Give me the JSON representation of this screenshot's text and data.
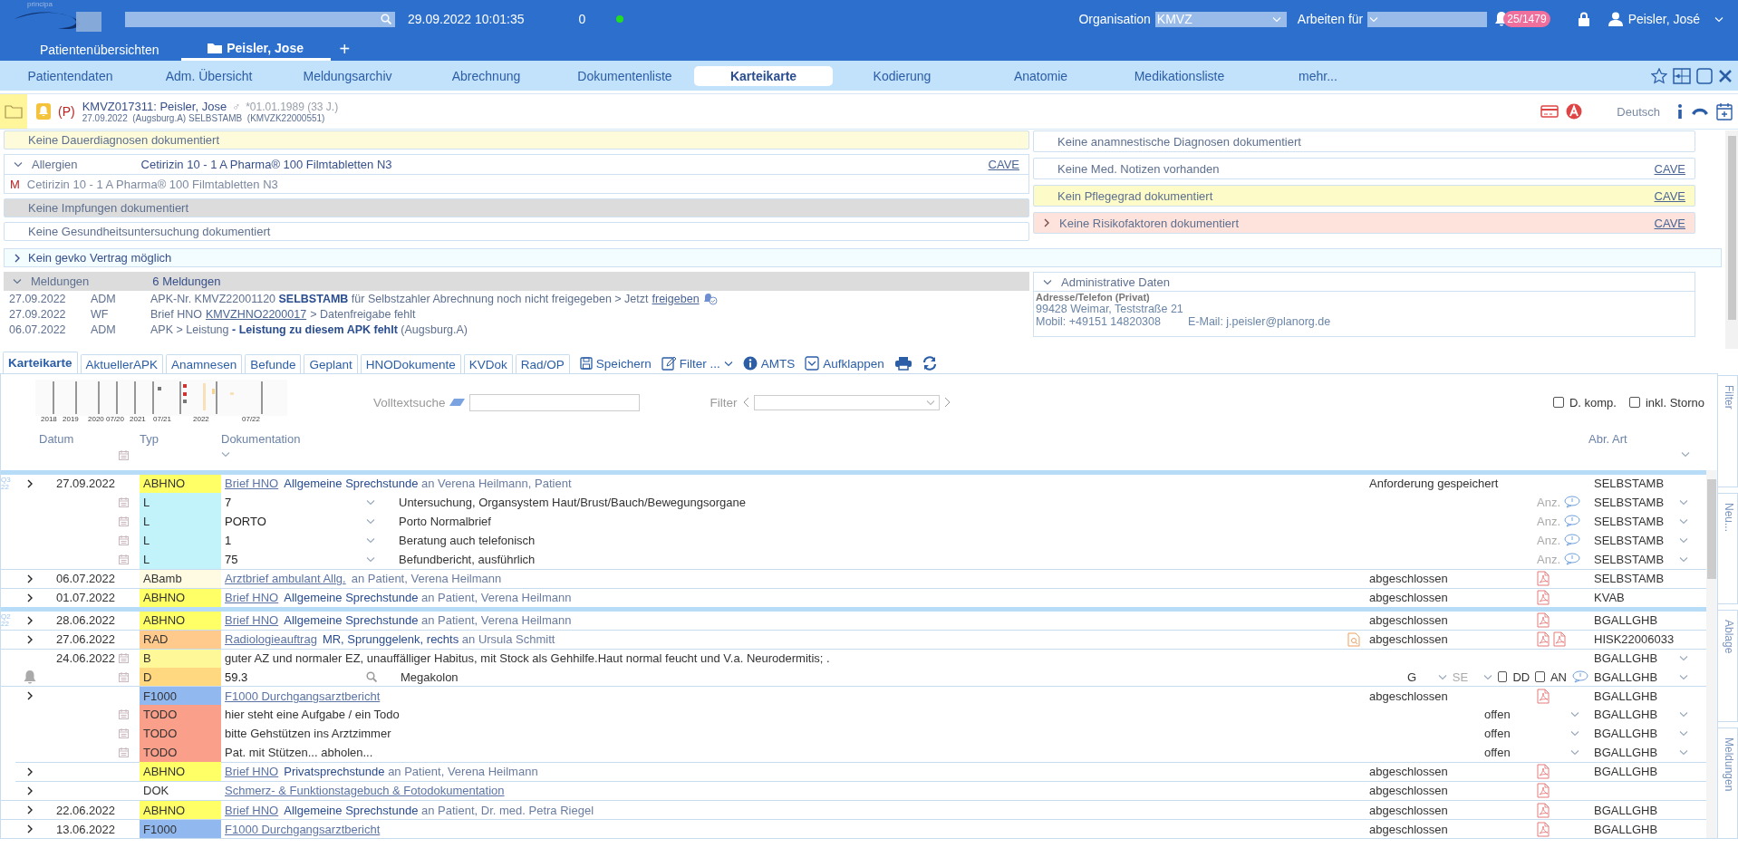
{
  "header": {
    "logo_text": "principa",
    "datetime": "29.09.2022 10:01:35",
    "counter": "0",
    "online": true,
    "organisation": {
      "label": "Organisation",
      "value": "KMVZ"
    },
    "work_for": {
      "label": "Arbeiten für"
    },
    "notifications": "25/1479",
    "user": "Peisler, José"
  },
  "patient_tabs": [
    {
      "label": "Patientenübersichten",
      "selected": false,
      "kind": "list"
    },
    {
      "label": "Peisler, Jose",
      "selected": true,
      "kind": "patient"
    }
  ],
  "add_tab": "+",
  "nav_tabs": [
    {
      "label": "Patientendaten",
      "selected": false
    },
    {
      "label": "Adm. Übersicht",
      "selected": false
    },
    {
      "label": "Meldungsarchiv",
      "selected": false
    },
    {
      "label": "Abrechnung",
      "selected": false
    },
    {
      "label": "Dokumentenliste",
      "selected": false
    },
    {
      "label": "Karteikarte",
      "selected": true
    },
    {
      "label": "Kodierung",
      "selected": false
    },
    {
      "label": "Anatomie",
      "selected": false
    },
    {
      "label": "Medikationsliste",
      "selected": false
    },
    {
      "label": "mehr...",
      "selected": false
    }
  ],
  "patient": {
    "flag": "(P)",
    "title": "KMVZ017311: Peisler, Jose",
    "gender_symbol": "♂",
    "birth": "*01.01.1989 (33 J.)",
    "subline": "27.09.2022  (Augsburg.A) SELBSTAMB  (KMVZK22000551)",
    "language": "Deutsch"
  },
  "summary_left": [
    {
      "kind": "note",
      "text": "Keine Dauerdiagnosen dokumentiert",
      "color": "#fdfbd9"
    },
    {
      "kind": "detail",
      "label": "Allergien",
      "value": "Cetirizin 10 - 1 A Pharma® 100 Filmtabletten N3",
      "link": "CAVE",
      "expanded": true,
      "items": [
        {
          "marker": "M",
          "text": "Cetirizin 10 - 1 A Pharma® 100 Filmtabletten N3"
        }
      ]
    },
    {
      "kind": "note",
      "text": "Keine Impfungen dokumentiert",
      "color": "#dcdcdc"
    },
    {
      "kind": "note",
      "text": "Keine Gesundheitsuntersuchung dokumentiert",
      "color": "#ffffff"
    }
  ],
  "summary_right": [
    {
      "kind": "note",
      "text": "Keine anamnestische Diagnosen dokumentiert",
      "color": "#ffffff"
    },
    {
      "kind": "note",
      "text": "Keine Med. Notizen vorhanden",
      "color": "#ffffff",
      "link": "CAVE"
    },
    {
      "kind": "note",
      "text": "Kein Pflegegrad dokumentiert",
      "color": "#fdfbc8",
      "link": "CAVE"
    },
    {
      "kind": "note",
      "text": "Keine Risikofaktoren dokumentiert",
      "color": "#fde3dc",
      "link": "CAVE",
      "expanded": false
    }
  ],
  "gevko": {
    "text": "Kein gevko Vertrag möglich",
    "expanded": false
  },
  "messages": {
    "label": "Meldungen",
    "summary": "6 Meldungen",
    "expanded": true,
    "rows": [
      {
        "date": "27.09.2022",
        "type": "ADM",
        "text": "APK-Nr. KMVZ22001120 **SELBSTAMB** für Selbstzahler Abrechnung noch nicht freigegeben > Jetzt",
        "link": "freigeben",
        "icon": true
      },
      {
        "date": "27.09.2022",
        "type": "WF",
        "text": "Brief HNO",
        "link": "KMVZHNO2200017",
        "after": "> Datenfreigabe fehlt",
        "icon": false
      },
      {
        "date": "06.07.2022",
        "type": "ADM",
        "text": "APK > Leistung **- Leistung zu diesem APK fehlt** (Augsburg.A)",
        "icon": false
      }
    ]
  },
  "admin": {
    "label": "Administrative Daten",
    "expanded": true,
    "heading": "Adresse/Telefon (Privat)",
    "address": "99428 Weimar, Teststraße 21",
    "phone": "Mobil: +49151 14820308",
    "email": "E-Mail: j.peisler@planorg.de"
  },
  "toolbar": {
    "tabs": [
      {
        "label": "Karteikarte",
        "selected": true
      },
      {
        "label": "AktuellerAPK",
        "selected": false
      },
      {
        "label": "Anamnesen",
        "selected": false
      },
      {
        "label": "Befunde",
        "selected": false
      },
      {
        "label": "Geplant",
        "selected": false
      },
      {
        "label": "HNODokumente",
        "selected": false
      },
      {
        "label": "KVDok",
        "selected": false
      },
      {
        "label": "Rad/OP",
        "selected": false
      }
    ],
    "actions": [
      {
        "kind": "save",
        "label": "Speichern"
      },
      {
        "kind": "filter",
        "label": "Filter ..."
      },
      {
        "kind": "info",
        "label": "AMTS"
      },
      {
        "kind": "expand",
        "label": "Aufklappen"
      },
      {
        "kind": "print"
      },
      {
        "kind": "refresh"
      }
    ]
  },
  "journal": {
    "timeline_labels": [
      "2018",
      "2019",
      "2020",
      "07/20",
      "2021",
      "07/21",
      "2022",
      "07/22"
    ],
    "fulltext_label": "Volltextsuche",
    "filter_label": "Filter",
    "options": [
      {
        "label": "D. komp.",
        "checked": false
      },
      {
        "label": "inkl. Storno",
        "checked": false
      }
    ],
    "columns": [
      "Datum",
      "Typ",
      "Dokumentation",
      "Abr. Art"
    ],
    "rows": [
      {
        "kind": "entry",
        "group_start": true,
        "quarter": "Q3 22",
        "expander": true,
        "date": "27.09.2022",
        "type": "ABHNO",
        "color": "#ffff66",
        "link": "Brief HNO",
        "text": "**Allgemeine Sprechstunde** an Verena Heilmann, Patient",
        "status": "Anforderung gespeichert",
        "abr": "SELBSTAMB"
      },
      {
        "kind": "service",
        "calendar": true,
        "type": "L",
        "color": "#c2f3fb",
        "code": "7",
        "text": "Untersuchung, Organsystem Haut/Brust/Bauch/Bewegungsorgane",
        "count_label": "Anz.",
        "abr": "SELBSTAMB",
        "menu": true
      },
      {
        "kind": "service",
        "calendar": true,
        "type": "L",
        "color": "#c2f3fb",
        "code": "PORTO",
        "text": "Porto Normalbrief",
        "count_label": "Anz.",
        "abr": "SELBSTAMB",
        "menu": true
      },
      {
        "kind": "service",
        "calendar": true,
        "type": "L",
        "color": "#c2f3fb",
        "code": "1",
        "text": "Beratung auch telefonisch",
        "count_label": "Anz.",
        "abr": "SELBSTAMB",
        "menu": true
      },
      {
        "kind": "service",
        "calendar": true,
        "type": "L",
        "color": "#c2f3fb",
        "code": "75",
        "text": "Befundbericht, ausführlich",
        "count_label": "Anz.",
        "abr": "SELBSTAMB",
        "menu": true
      },
      {
        "kind": "entry",
        "expander": true,
        "date": "06.07.2022",
        "type": "ABamb",
        "color": "#fffbe3",
        "link": "Arztbrief ambulant Allg.",
        "text": "an Patient, Verena Heilmann",
        "status": "abgeschlossen",
        "files": [
          {
            "kind": "pdf"
          }
        ],
        "abr": "SELBSTAMB"
      },
      {
        "kind": "entry",
        "expander": true,
        "date": "01.07.2022",
        "type": "ABHNO",
        "color": "#ffff66",
        "link": "Brief HNO",
        "text": "**Allgemeine Sprechstunde** an Patient, Verena Heilmann",
        "status": "abgeschlossen",
        "files": [
          {
            "kind": "pdf"
          }
        ],
        "abr": "KVAB"
      },
      {
        "kind": "entry",
        "group_start": true,
        "quarter": "Q2 22",
        "expander": true,
        "date": "28.06.2022",
        "type": "ABHNO",
        "color": "#ffff66",
        "link": "Brief HNO",
        "text": "**Allgemeine Sprechstunde** an Patient, Verena Heilmann",
        "status": "abgeschlossen",
        "files": [
          {
            "kind": "pdf"
          }
        ],
        "abr": "BGALLGHB"
      },
      {
        "kind": "entry",
        "expander": true,
        "date": "27.06.2022",
        "type": "RAD",
        "color": "#ffca8c",
        "link": "Radiologieauftrag",
        "text": "**MR, Sprunggelenk, rechts** an Ursula Schmitt",
        "preview": true,
        "status": "abgeschlossen",
        "files": [
          {
            "kind": "pdf"
          },
          {
            "kind": "pdf"
          }
        ],
        "abr": "HISK22006033"
      },
      {
        "kind": "note",
        "date": "24.06.2022",
        "calendar": true,
        "type": "B",
        "color": "#fff899",
        "text": "guter AZ und normaler EZ, unauffälliger Habitus, mit Stock als Gehhilfe.Haut normal feucht und V.a. Neurodermitis; .",
        "abr": "BGALLGHB",
        "menu": true
      },
      {
        "kind": "diagnosis",
        "alarm": true,
        "calendar": true,
        "type": "D",
        "color": "#ffd880",
        "code": "59.3",
        "text": "Megakolon",
        "certainty": "G",
        "side": "SE",
        "flags": [
          {
            "label": "DD",
            "checked": false
          },
          {
            "label": "AN",
            "checked": false
          }
        ],
        "comment": true,
        "abr": "BGALLGHB",
        "menu": true
      },
      {
        "kind": "entry",
        "expander": true,
        "type": "F1000",
        "color": "#91b9f0",
        "link": "F1000 Durchgangsarztbericht",
        "status": "abgeschlossen",
        "files": [
          {
            "kind": "pdf"
          }
        ],
        "abr": "BGALLGHB"
      },
      {
        "kind": "todo",
        "calendar": true,
        "type": "TODO",
        "color": "#fa9f8a",
        "text": "hier steht eine Aufgabe / ein Todo",
        "status": "offen",
        "abr": "BGALLGHB",
        "menu": true
      },
      {
        "kind": "todo",
        "calendar": true,
        "type": "TODO",
        "color": "#fa9f8a",
        "text": "bitte Gehstützen ins Arztzimmer",
        "status": "offen",
        "abr": "BGALLGHB",
        "menu": true
      },
      {
        "kind": "todo",
        "calendar": true,
        "type": "TODO",
        "color": "#fa9f8a",
        "text": "Pat. mit Stützen... abholen...",
        "status": "offen",
        "abr": "BGALLGHB",
        "menu": true
      },
      {
        "kind": "entry",
        "expander": true,
        "sub": true,
        "type": "ABHNO",
        "color": "#ffff66",
        "link": "Brief HNO",
        "text": "**Privatsprechstunde** an Patient, Verena Heilmann",
        "status": "abgeschlossen",
        "files": [
          {
            "kind": "pdf"
          }
        ],
        "abr": "BGALLGHB"
      },
      {
        "kind": "entry",
        "expander": true,
        "sub": true,
        "type": "DOK",
        "link": "Schmerz- & Funktionstagebuch & Fotodokumentation",
        "status": "abgeschlossen",
        "files": [
          {
            "kind": "pdf"
          }
        ]
      },
      {
        "kind": "entry",
        "expander": true,
        "date": "22.06.2022",
        "type": "ABHNO",
        "color": "#ffff66",
        "link": "Brief HNO",
        "text": "**Allgemeine Sprechstunde** an Patient, Dr. med. Petra Riegel",
        "status": "abgeschlossen",
        "files": [
          {
            "kind": "pdf"
          }
        ],
        "abr": "BGALLGHB"
      },
      {
        "kind": "entry",
        "expander": true,
        "date": "13.06.2022",
        "type": "F1000",
        "color": "#91b9f0",
        "link": "F1000 Durchgangsarztbericht",
        "status": "abgeschlossen",
        "files": [
          {
            "kind": "pdf"
          }
        ],
        "abr": "BGALLGHB"
      }
    ],
    "side_tabs": [
      "Filter",
      "Neu...",
      "Ablage",
      "Meldungen"
    ]
  }
}
